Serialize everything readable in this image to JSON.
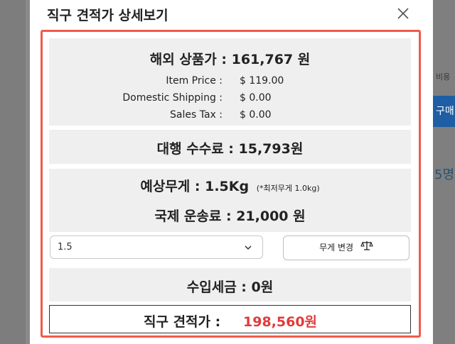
{
  "modal": {
    "title": "직구 견적가 상세보기"
  },
  "overseas": {
    "price_line": "해외 상품가 : 161,767 원",
    "rows": [
      {
        "label": "Item Price :",
        "value": "$ 119.00"
      },
      {
        "label": "Domestic Shipping :",
        "value": "$ 0.00"
      },
      {
        "label": "Sales Tax :",
        "value": "$ 0.00"
      }
    ]
  },
  "agency_fee": "대행 수수료 : 15,793원",
  "weight": {
    "line": "예상무게 : 1.5Kg",
    "note": "(*최저무게 1.0kg)"
  },
  "shipping": "국제 운송료 : 21,000 원",
  "weight_select": {
    "value": "1.5"
  },
  "change_weight_button": "무게 변경",
  "import_tax": "수입세금 : 0원",
  "total": {
    "label": "직구 견적가 :",
    "amount": "198,560원"
  },
  "background": {
    "right_text": "비용",
    "right_button": "구매",
    "right_logo": "5명"
  },
  "colors": {
    "highlight_frame": "#f05a4b",
    "total_amount": "#e23a3a",
    "panel_bg": "#efefef"
  }
}
